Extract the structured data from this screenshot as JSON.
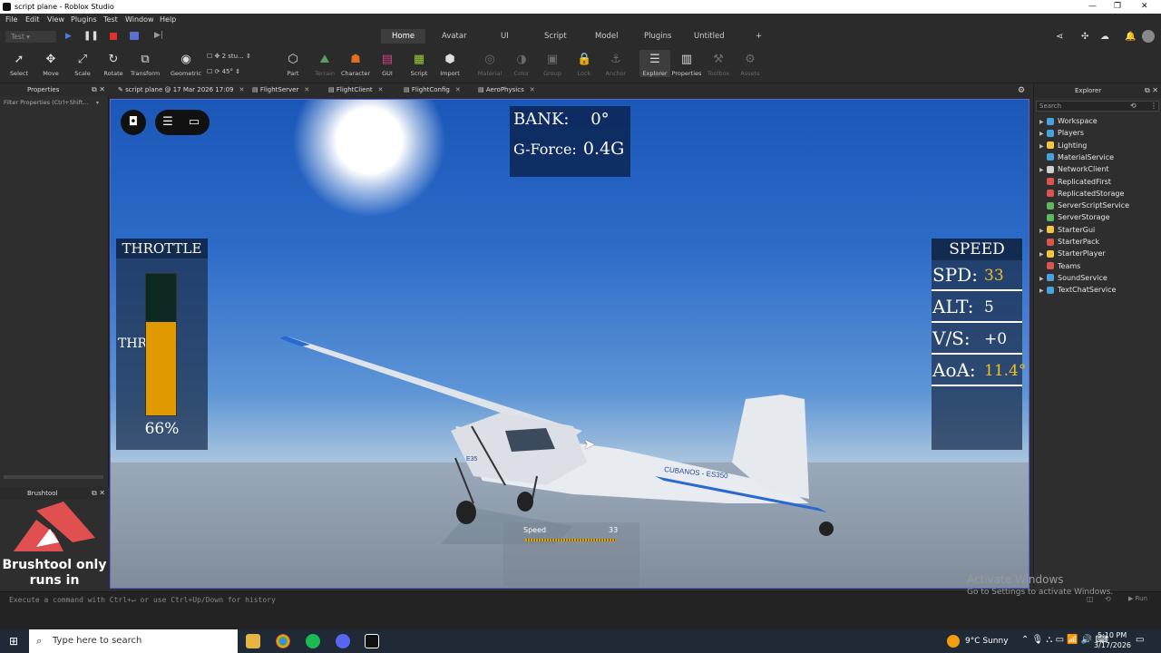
{
  "window": {
    "title": "script plane - Roblox Studio"
  },
  "menu": [
    "File",
    "Edit",
    "View",
    "Plugins",
    "Test",
    "Window",
    "Help"
  ],
  "test_mode": "Test",
  "main_tabs": [
    {
      "label": "Home",
      "active": true
    },
    {
      "label": "Avatar"
    },
    {
      "label": "UI"
    },
    {
      "label": "Script"
    },
    {
      "label": "Model"
    },
    {
      "label": "Plugins"
    },
    {
      "label": "Untitled"
    },
    {
      "label": "+"
    }
  ],
  "toolbar": {
    "tools": [
      "Select",
      "Move",
      "Scale",
      "Rotate",
      "Transform",
      "Geometric",
      "Part",
      "Terrain",
      "Character",
      "GUI",
      "Script",
      "Import",
      "Material",
      "Color",
      "Group",
      "Lock",
      "Anchor",
      "Explorer",
      "Properties",
      "Toolbox",
      "Assets"
    ],
    "snap_move": "2 stu...",
    "snap_rotate": "45°"
  },
  "doc_tabs": [
    "script plane @ 17 Mar 2026 17:09",
    "FlightServer",
    "FlightClient",
    "FlightConfig",
    "AeroPhysics"
  ],
  "properties": {
    "title": "Properties",
    "filter_placeholder": "Filter Properties (Ctrl+Shift..."
  },
  "brushtool": {
    "title": "Brushtool",
    "message": "Brushtool only runs in"
  },
  "hud": {
    "bank_label": "BANK:",
    "bank_value": "0°",
    "gforce_label": "G-Force:",
    "gforce_value": "0.4G",
    "throttle_title": "THROTTLE",
    "throttle_label": "THR",
    "throttle_pct": "66%",
    "throttle_level": 0.66,
    "speed_title": "SPEED",
    "rows": [
      {
        "k": "SPD:",
        "v": "33",
        "color": "#f0c020"
      },
      {
        "k": "ALT:",
        "v": "5",
        "color": "#ffffff"
      },
      {
        "k": "V/S:",
        "v": "+0",
        "color": "#ffffff"
      },
      {
        "k": "AoA:",
        "v": "11.4°",
        "color": "#f0c020"
      }
    ],
    "mini_label": "Speed",
    "mini_value": "33"
  },
  "plane": {
    "livery": "CUBANOS - ES350",
    "tailnum": "E35"
  },
  "explorer": {
    "title": "Explorer",
    "search_placeholder": "Search",
    "items": [
      {
        "name": "Workspace",
        "expand": true,
        "color": "#4aa3df"
      },
      {
        "name": "Players",
        "expand": true,
        "color": "#4aa3df"
      },
      {
        "name": "Lighting",
        "expand": true,
        "color": "#f4c542"
      },
      {
        "name": "MaterialService",
        "expand": false,
        "color": "#4aa3df"
      },
      {
        "name": "NetworkClient",
        "expand": true,
        "color": "#d0d0d0"
      },
      {
        "name": "ReplicatedFirst",
        "expand": false,
        "color": "#d9534f"
      },
      {
        "name": "ReplicatedStorage",
        "expand": false,
        "color": "#d9534f"
      },
      {
        "name": "ServerScriptService",
        "expand": false,
        "color": "#5cb85c"
      },
      {
        "name": "ServerStorage",
        "expand": false,
        "color": "#5cb85c"
      },
      {
        "name": "StarterGui",
        "expand": true,
        "color": "#f4c542"
      },
      {
        "name": "StarterPack",
        "expand": false,
        "color": "#d9534f"
      },
      {
        "name": "StarterPlayer",
        "expand": true,
        "color": "#f4c542"
      },
      {
        "name": "Teams",
        "expand": false,
        "color": "#d9534f"
      },
      {
        "name": "SoundService",
        "expand": true,
        "color": "#4aa3df"
      },
      {
        "name": "TextChatService",
        "expand": true,
        "color": "#4aa3df"
      }
    ]
  },
  "command_bar": {
    "placeholder": "Execute a command with Ctrl+↵ or use Ctrl+Up/Down for history",
    "run_label": "Run"
  },
  "watermark": {
    "line1": "Activate Windows",
    "line2": "Go to Settings to activate Windows."
  },
  "taskbar": {
    "search": "Type here to search",
    "weather": "9°C  Sunny",
    "time": "5:10 PM",
    "date": "3/17/2026"
  }
}
